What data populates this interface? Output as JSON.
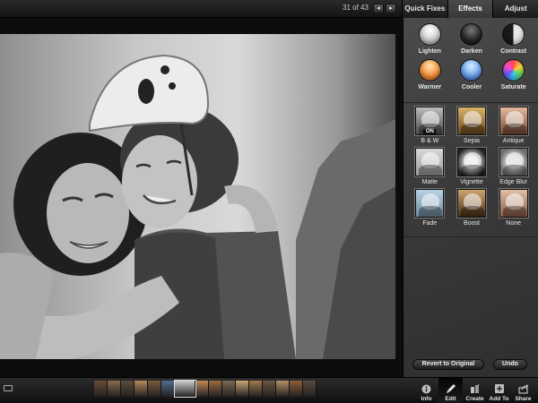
{
  "topbar": {
    "photo_counter": "31 of 43",
    "prev_icon": "◂",
    "next_icon": "▸",
    "tabs": [
      {
        "label": "Quick Fixes",
        "active": false
      },
      {
        "label": "Effects",
        "active": true
      },
      {
        "label": "Adjust",
        "active": false
      }
    ]
  },
  "quick_fixes": [
    {
      "label": "Lighten",
      "icon": "lighten-orb"
    },
    {
      "label": "Darken",
      "icon": "darken-orb"
    },
    {
      "label": "Contrast",
      "icon": "contrast-orb"
    },
    {
      "label": "Warmer",
      "icon": "warmer-orb"
    },
    {
      "label": "Cooler",
      "icon": "cooler-orb"
    },
    {
      "label": "Saturate",
      "icon": "saturate-orb"
    }
  ],
  "effects": [
    {
      "label": "B & W",
      "badge": "ON"
    },
    {
      "label": "Sepia"
    },
    {
      "label": "Antique"
    },
    {
      "label": "Matte"
    },
    {
      "label": "Vignette"
    },
    {
      "label": "Edge Blur"
    },
    {
      "label": "Fade"
    },
    {
      "label": "Boost"
    },
    {
      "label": "None"
    }
  ],
  "actions": {
    "revert_label": "Revert to Original",
    "undo_label": "Undo"
  },
  "filmstrip": {
    "current_index": 6,
    "thumb_colors": [
      "#6b4a33",
      "#8a6a4e",
      "#5d4c3e",
      "#b8885a",
      "#7a5a3d",
      "#4f6e8e",
      "#cfcfcf",
      "#c08a55",
      "#9c6b3f",
      "#7e6a52",
      "#c9a574",
      "#a07a50",
      "#6d5641",
      "#b59165",
      "#8f5e3a",
      "#5a4b40"
    ]
  },
  "tools": [
    {
      "label": "Info",
      "icon": "info-icon",
      "active": false
    },
    {
      "label": "Edit",
      "icon": "brush-icon",
      "active": true
    },
    {
      "label": "Create",
      "icon": "create-icon",
      "active": false
    },
    {
      "label": "Add To",
      "icon": "add-to-icon",
      "active": false
    },
    {
      "label": "Share",
      "icon": "share-icon",
      "active": false
    }
  ],
  "colors": {
    "panel_bg": "#3b3b3b",
    "bar_bg": "#141414",
    "tab_active": "#444444"
  }
}
